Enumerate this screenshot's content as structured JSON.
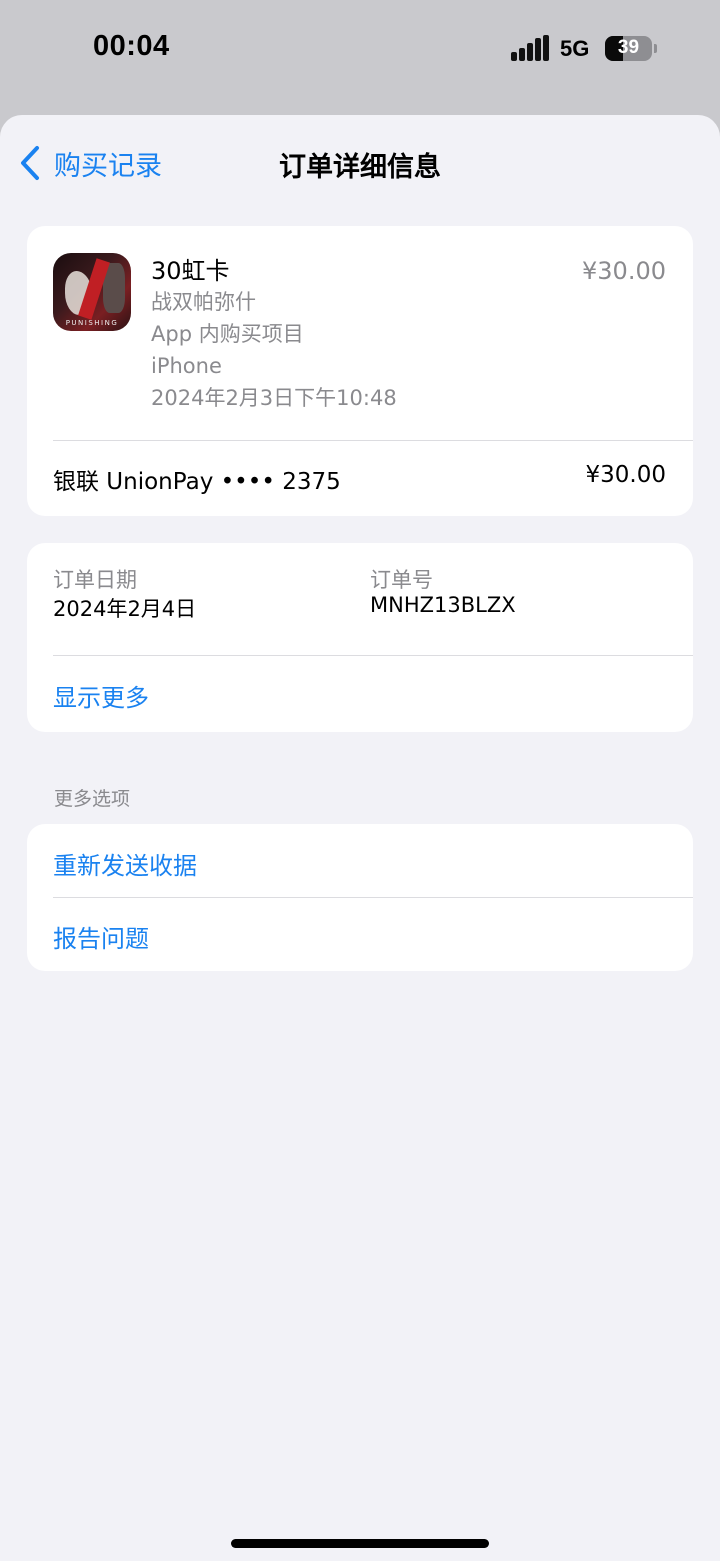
{
  "status_bar": {
    "time": "00:04",
    "network": "5G",
    "battery": "39",
    "battery_level": 0.39,
    "signal_icon": "cellular-signal-icon"
  },
  "nav": {
    "back_label": "购买记录",
    "title": "订单详细信息",
    "back_icon": "chevron-left-icon"
  },
  "purchase": {
    "icon_caption": "PUNISHING",
    "item_name": "30虹卡",
    "app_name": "战双帕弥什",
    "type": "App 内购买项目",
    "device": "iPhone",
    "datetime": "2024年2月3日下午10:48",
    "price": "¥30.00",
    "payment_method": "银联 UnionPay •••• 2375",
    "payment_amount": "¥30.00"
  },
  "order": {
    "date_label": "订单日期",
    "date_value": "2024年2月4日",
    "number_label": "订单号",
    "number_value": "MNHZ13BLZX",
    "show_more": "显示更多"
  },
  "more_options": {
    "header": "更多选项",
    "resend_receipt": "重新发送收据",
    "report_problem": "报告问题"
  },
  "colors": {
    "accent": "#1a82f0",
    "background": "#f2f2f7",
    "secondary_text": "#8a8a8e"
  }
}
